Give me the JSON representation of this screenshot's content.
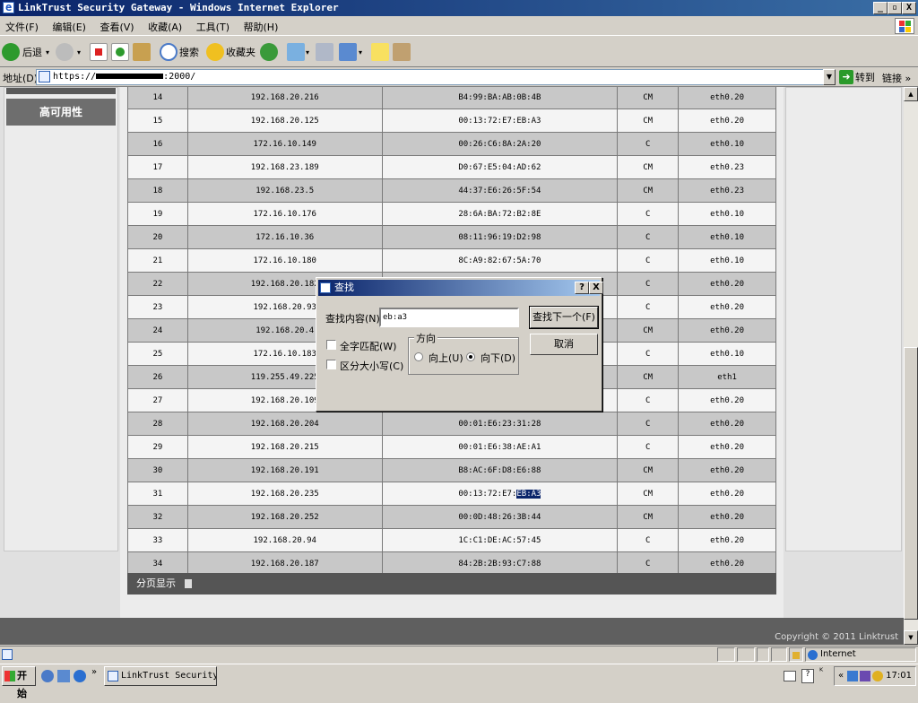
{
  "window": {
    "title": "LinkTrust Security Gateway - Windows Internet Explorer",
    "controls": [
      "_",
      "▫",
      "X"
    ]
  },
  "menu": [
    "文件(F)",
    "编辑(E)",
    "查看(V)",
    "收藏(A)",
    "工具(T)",
    "帮助(H)"
  ],
  "toolbar": {
    "back_label": "后退",
    "search_label": "搜索",
    "favorites_label": "收藏夹"
  },
  "address": {
    "label": "地址(D)",
    "prefix": "https://",
    "suffix": ":2000/",
    "go_label": "转到",
    "links_label": "链接 »"
  },
  "sidebar": {
    "item_label": "高可用性"
  },
  "table": {
    "rows": [
      [
        "14",
        "192.168.20.216",
        "B4:99:BA:AB:0B:4B",
        "CM",
        "eth0.20"
      ],
      [
        "15",
        "192.168.20.125",
        "00:13:72:E7:EB:A3",
        "CM",
        "eth0.20"
      ],
      [
        "16",
        "172.16.10.149",
        "00:26:C6:8A:2A:20",
        "C",
        "eth0.10"
      ],
      [
        "17",
        "192.168.23.189",
        "D0:67:E5:04:AD:62",
        "CM",
        "eth0.23"
      ],
      [
        "18",
        "192.168.23.5",
        "44:37:E6:26:5F:54",
        "CM",
        "eth0.23"
      ],
      [
        "19",
        "172.16.10.176",
        "28:6A:BA:72:B2:8E",
        "C",
        "eth0.10"
      ],
      [
        "20",
        "172.16.10.36",
        "08:11:96:19:D2:98",
        "C",
        "eth0.10"
      ],
      [
        "21",
        "172.16.10.180",
        "8C:A9:82:67:5A:70",
        "C",
        "eth0.10"
      ],
      [
        "22",
        "192.168.20.182",
        "",
        "C",
        "eth0.20"
      ],
      [
        "23",
        "192.168.20.93",
        "",
        "C",
        "eth0.20"
      ],
      [
        "24",
        "192.168.20.4",
        "",
        "CM",
        "eth0.20"
      ],
      [
        "25",
        "172.16.10.183",
        "",
        "C",
        "eth0.10"
      ],
      [
        "26",
        "119.255.49.225",
        "",
        "CM",
        "eth1"
      ],
      [
        "27",
        "192.168.20.109",
        "",
        "C",
        "eth0.20"
      ],
      [
        "28",
        "192.168.20.204",
        "00:01:E6:23:31:28",
        "C",
        "eth0.20"
      ],
      [
        "29",
        "192.168.20.215",
        "00:01:E6:38:AE:A1",
        "C",
        "eth0.20"
      ],
      [
        "30",
        "192.168.20.191",
        "B8:AC:6F:D8:E6:88",
        "CM",
        "eth0.20"
      ],
      [
        "31",
        "192.168.20.235",
        "00:13:72:E7:",
        "CM",
        "eth0.20"
      ],
      [
        "32",
        "192.168.20.252",
        "00:0D:48:26:3B:44",
        "CM",
        "eth0.20"
      ],
      [
        "33",
        "192.168.20.94",
        "1C:C1:DE:AC:57:45",
        "C",
        "eth0.20"
      ],
      [
        "34",
        "192.168.20.187",
        "84:2B:2B:93:C7:88",
        "C",
        "eth0.20"
      ]
    ],
    "highlight_row_index": 17,
    "highlight_text": "EB:A3"
  },
  "pager": {
    "label": "分页显示"
  },
  "footer": {
    "copyright": "Copyright © 2011 Linktrust"
  },
  "statusbar": {
    "zone": "Internet"
  },
  "taskbar": {
    "start_label": "开始",
    "task_label": "LinkTrust Security ...",
    "clock": "17:01"
  },
  "find_dialog": {
    "title": "查找",
    "help_btn": "?",
    "close_btn": "X",
    "find_label": "查找内容(N):",
    "find_value": "eb:a3",
    "find_next_label": "查找下一个(F)",
    "cancel_label": "取消",
    "whole_word_label": "全字匹配(W)",
    "match_case_label": "区分大小写(C)",
    "direction_label": "方向",
    "up_label": "向上(U)",
    "down_label": "向下(D)",
    "direction_selected": "down"
  },
  "colors": {
    "titlebar_start": "#0a246a",
    "titlebar_end": "#3a6ea5",
    "highlight": "#0a246a"
  }
}
